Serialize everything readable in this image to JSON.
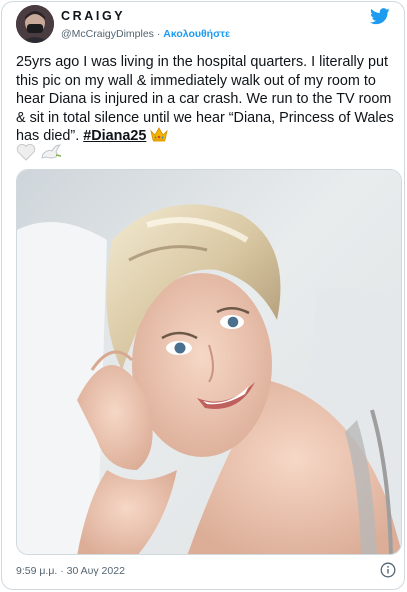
{
  "user": {
    "display_name": "CRAIGY",
    "handle": "@McCraigyDimples",
    "separator": " · ",
    "follow_label": "Ακολουθήστε",
    "avatar": "profile-photo"
  },
  "icons": {
    "brand": "twitter-bird-icon",
    "info": "info-icon"
  },
  "tweet": {
    "text": "25yrs ago I was living in the hospital quarters. I literally put this pic on my wall & immediately walk out of my room to hear Diana is injured in a car crash. We run to the TV room & sit in total silence until we hear “Diana, Princess of Wales has died”. ",
    "hashtag": "#Diana25",
    "emojis": [
      "crown",
      "white-heart",
      "dove"
    ],
    "image": "photo-diana-smiling-portrait"
  },
  "timestamp": "9:59 μ.μ. · 30 Αυγ 2022",
  "colors": {
    "accent": "#1d9bf0",
    "text": "#0f1419",
    "muted": "#536471",
    "border": "#cfd9de"
  }
}
